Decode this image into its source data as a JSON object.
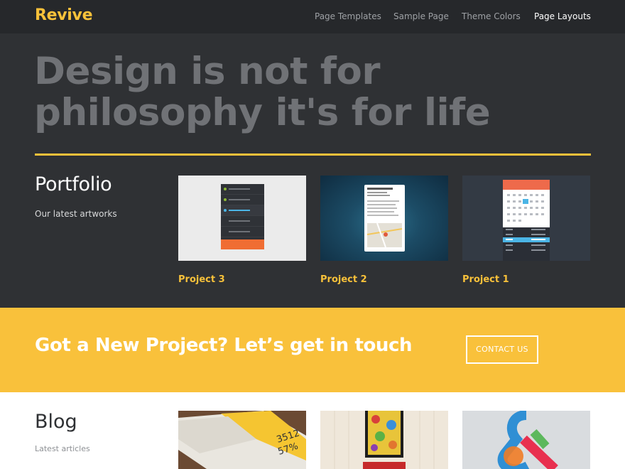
{
  "brand": "Revive",
  "nav": [
    {
      "label": "Page Templates",
      "active": false
    },
    {
      "label": "Sample Page",
      "active": false
    },
    {
      "label": "Theme Colors",
      "active": false
    },
    {
      "label": "Page Layouts",
      "active": true
    }
  ],
  "hero": {
    "headline_line1": "Design is not for",
    "headline_line2": "philosophy it's for life"
  },
  "portfolio": {
    "title": "Portfolio",
    "subtitle": "Our latest artworks",
    "projects": [
      {
        "label": "Project 3"
      },
      {
        "label": "Project 2"
      },
      {
        "label": "Project 1"
      }
    ]
  },
  "cta": {
    "text": "Got a New Project? Let’s get in touch",
    "button": "CONTACT US"
  },
  "blog": {
    "title": "Blog",
    "subtitle": "Latest articles"
  },
  "colors": {
    "accent": "#f8c13a",
    "dark_bg": "#2f3134",
    "nav_bg": "#26282b"
  }
}
